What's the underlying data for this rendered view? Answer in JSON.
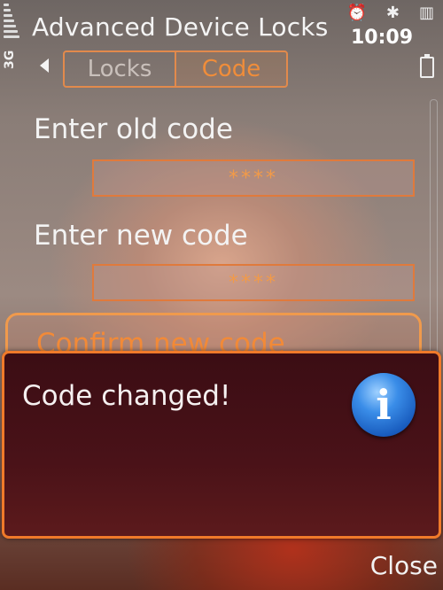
{
  "header": {
    "title": "Advanced Device Locks",
    "network_type": "3G",
    "clock": "10:09",
    "status_icons": [
      "alarm-icon",
      "bluetooth-icon",
      "keypad-lock-icon"
    ]
  },
  "tabs": [
    {
      "label": "Locks",
      "active": false
    },
    {
      "label": "Code",
      "active": true
    }
  ],
  "form": {
    "old_code_label": "Enter old code",
    "old_code_value": "****",
    "new_code_label": "Enter new code",
    "new_code_value": "****",
    "confirm_label": "Confirm new code"
  },
  "dialog": {
    "message": "Code changed!",
    "icon": "info-icon"
  },
  "softkeys": {
    "right": "Close"
  },
  "colors": {
    "accent": "#f08d3a",
    "dialog_border": "#f07a2a",
    "dialog_bg": "#3b0d14",
    "info_blue": "#1455b8"
  }
}
